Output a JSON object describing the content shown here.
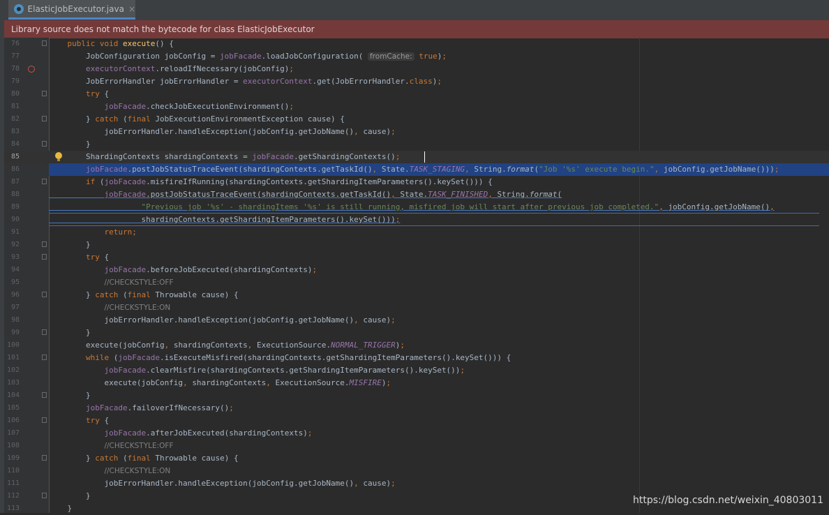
{
  "tab": {
    "filename": "ElasticJobExecutor.java",
    "close": "×",
    "icon": "java-class-file-icon"
  },
  "banner": {
    "text": "Library source does not match the bytecode for class ElasticJobExecutor"
  },
  "watermark": "https://blog.csdn.net/weixin_40803011",
  "colors": {
    "keyword": "#cc7832",
    "method": "#ffc66d",
    "field": "#9876aa",
    "string": "#6a8759",
    "comment": "#808080",
    "selection": "#214283",
    "banner": "#743a3a"
  },
  "lines": [
    {
      "n": "76",
      "html": "    <span class='k'>public void </span><span class='fn'>execute</span>() {"
    },
    {
      "n": "77",
      "html": "        JobConfiguration jobConfig = <span class='f'>jobFacade</span>.loadJobConfiguration( <span class='hint'>fromCache:</span> <span class='k'>true</span>)<span class='k'>;</span>"
    },
    {
      "n": "78",
      "html": "        <span class='f'>executorContext</span>.reloadIfNecessary(jobConfig)<span class='k'>;</span>"
    },
    {
      "n": "79",
      "html": "        JobErrorHandler jobErrorHandler = <span class='f'>executorContext</span>.get(JobErrorHandler.<span class='k'>class</span>)<span class='k'>;</span>"
    },
    {
      "n": "80",
      "html": "        <span class='k'>try </span>{"
    },
    {
      "n": "81",
      "html": "            <span class='f'>jobFacade</span>.checkJobExecutionEnvironment()<span class='k'>;</span>"
    },
    {
      "n": "82",
      "html": "        } <span class='k'>catch </span>(<span class='k'>final </span>JobExecutionEnvironmentException cause) {"
    },
    {
      "n": "83",
      "html": "            jobErrorHandler.handleException(jobConfig.getJobName()<span class='k'>, </span>cause)<span class='k'>;</span>"
    },
    {
      "n": "84",
      "html": "        }"
    },
    {
      "n": "85",
      "html": "        ShardingContexts shardingContexts = <span class='f'>jobFacade</span>.getShardingContexts()<span class='k'>;</span>"
    },
    {
      "n": "86",
      "html": "        <span class='f'>jobFacade</span>.postJobStatusTraceEvent(shardingContexts.getTaskId()<span class='k'>, </span>State.<span class='fi'>TASK_STAGING</span><span class='k'>, </span>String.<span class='it'>format</span>(<span class='s'>\"Job '%s' execute begin.\"</span><span class='k'>, </span>jobConfig.getJobName()))<span class='k'>;</span>"
    },
    {
      "n": "87",
      "html": "        <span class='k'>if </span>(<span class='f'>jobFacade</span>.misfireIfRunning(shardingContexts.getShardingItemParameters().keySet())) {"
    },
    {
      "n": "88",
      "html": "            <span class='f'>jobFacade</span>.postJobStatusTraceEvent(shardingContexts.getTaskId()<span class='k'>, </span>State.<span class='fi'>TASK_FINISHED</span><span class='k'>, </span>String.<span class='it'>format</span>("
    },
    {
      "n": "89",
      "html": "                    <span class='s'>\"Previous job '%s' - shardingItems '%s' is still running, misfired job will start after previous job completed.\"</span><span class='k'>, </span>jobConfig.getJobName()<span class='k'>,</span>"
    },
    {
      "n": "90",
      "html": "                    shardingContexts.getShardingItemParameters().keySet()))<span class='k'>;</span>"
    },
    {
      "n": "91",
      "html": "            <span class='k'>return;</span>"
    },
    {
      "n": "92",
      "html": "        }"
    },
    {
      "n": "93",
      "html": "        <span class='k'>try </span>{"
    },
    {
      "n": "94",
      "html": "            <span class='f'>jobFacade</span>.beforeJobExecuted(shardingContexts)<span class='k'>;</span>"
    },
    {
      "n": "95",
      "html": "            <span class='cm'>//CHECKSTYLE:OFF</span>"
    },
    {
      "n": "96",
      "html": "        } <span class='k'>catch </span>(<span class='k'>final </span>Throwable cause) {"
    },
    {
      "n": "97",
      "html": "            <span class='cm'>//CHECKSTYLE:ON</span>"
    },
    {
      "n": "98",
      "html": "            jobErrorHandler.handleException(jobConfig.getJobName()<span class='k'>, </span>cause)<span class='k'>;</span>"
    },
    {
      "n": "99",
      "html": "        }"
    },
    {
      "n": "100",
      "html": "        execute(jobConfig<span class='k'>, </span>shardingContexts<span class='k'>, </span>ExecutionSource.<span class='fi'>NORMAL_TRIGGER</span>)<span class='k'>;</span>"
    },
    {
      "n": "101",
      "html": "        <span class='k'>while </span>(<span class='f'>jobFacade</span>.isExecuteMisfired(shardingContexts.getShardingItemParameters().keySet())) {"
    },
    {
      "n": "102",
      "html": "            <span class='f'>jobFacade</span>.clearMisfire(shardingContexts.getShardingItemParameters().keySet())<span class='k'>;</span>"
    },
    {
      "n": "103",
      "html": "            execute(jobConfig<span class='k'>, </span>shardingContexts<span class='k'>, </span>ExecutionSource.<span class='fi'>MISFIRE</span>)<span class='k'>;</span>"
    },
    {
      "n": "104",
      "html": "        }"
    },
    {
      "n": "105",
      "html": "        <span class='f'>jobFacade</span>.failoverIfNecessary()<span class='k'>;</span>"
    },
    {
      "n": "106",
      "html": "        <span class='k'>try </span>{"
    },
    {
      "n": "107",
      "html": "            <span class='f'>jobFacade</span>.afterJobExecuted(shardingContexts)<span class='k'>;</span>"
    },
    {
      "n": "108",
      "html": "            <span class='cm'>//CHECKSTYLE:OFF</span>"
    },
    {
      "n": "109",
      "html": "        } <span class='k'>catch </span>(<span class='k'>final </span>Throwable cause) {"
    },
    {
      "n": "110",
      "html": "            <span class='cm'>//CHECKSTYLE:ON</span>"
    },
    {
      "n": "111",
      "html": "            jobErrorHandler.handleException(jobConfig.getJobName()<span class='k'>, </span>cause)<span class='k'>;</span>"
    },
    {
      "n": "112",
      "html": "        }"
    },
    {
      "n": "113",
      "html": "    }"
    }
  ]
}
